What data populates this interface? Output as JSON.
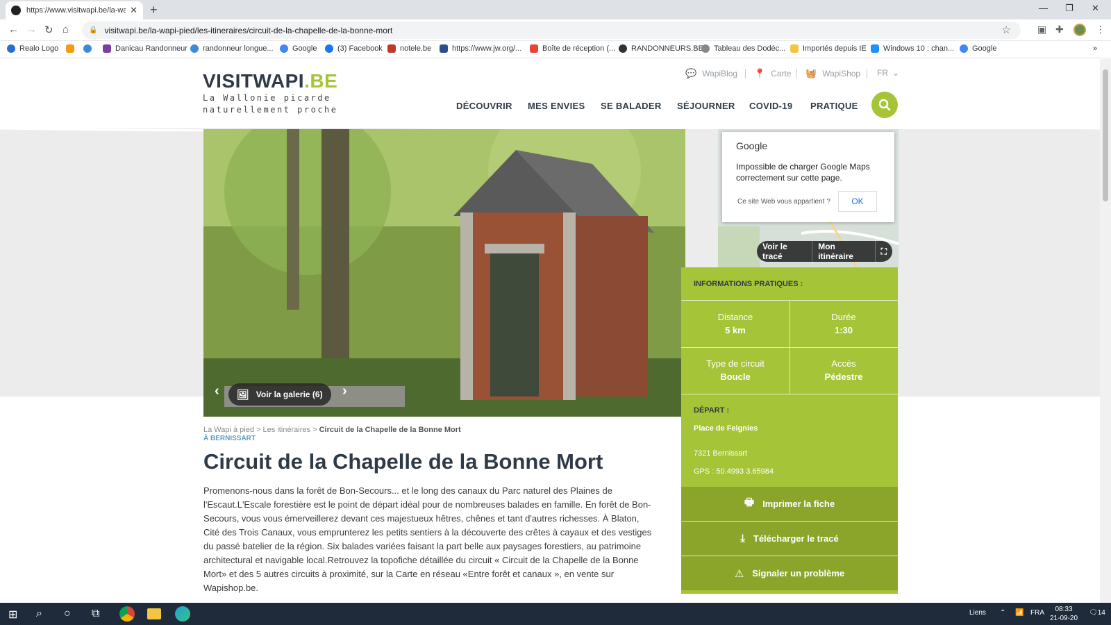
{
  "browser": {
    "tab_title": "https://www.visitwapi.be/la-wap",
    "url": "visitwapi.be/la-wapi-pied/les-itineraires/circuit-de-la-chapelle-de-la-bonne-mort",
    "bookmarks": [
      "Realo Logo",
      "",
      "",
      "Danicau Randonneur",
      "randonneur longue...",
      "Google",
      "(3) Facebook",
      "notele.be",
      "https://www.jw.org/...",
      "Boîte de réception (...",
      "RANDONNEURS.BE",
      "Tableau des Dodéc...",
      "Importés depuis IE",
      "Windows 10 : chan...",
      "Google"
    ]
  },
  "site": {
    "brand_main": "VISITWAPI",
    "brand_tld": ".BE",
    "tagline_1": "La Wallonie picarde",
    "tagline_2": "naturellement proche",
    "util_links": [
      "WapiBlog",
      "Carte",
      "WapiShop",
      "FR"
    ],
    "nav": [
      "DÉCOUVRIR",
      "MES ENVIES",
      "SE BALADER",
      "SÉJOURNER",
      "COVID-19",
      "PRATIQUE"
    ]
  },
  "hero": {
    "gallery_label": "Voir la galerie (6)"
  },
  "map": {
    "popup_title": "Google",
    "popup_message": "Impossible de charger Google Maps correctement sur cette page.",
    "popup_question": "Ce site Web vous appartient ?",
    "popup_ok": "OK",
    "btn_trace": "Voir le tracé",
    "btn_itinerary": "Mon itinéraire"
  },
  "info": {
    "header": "INFORMATIONS PRATIQUES :",
    "distance_label": "Distance",
    "distance_value": "5 km",
    "duration_label": "Durée",
    "duration_value": "1:30",
    "type_label": "Type de circuit",
    "type_value": "Boucle",
    "access_label": "Accès",
    "access_value": "Pédestre",
    "depart_label": "DÉPART :",
    "depart_place": "Place de Feignies",
    "depart_city": "7321 Bernissart",
    "gps": "GPS : 50.4993 3.65984",
    "btn_print": "Imprimer la fiche",
    "btn_download": "Télécharger le tracé",
    "btn_report": "Signaler un problème"
  },
  "article": {
    "crumb_1": "La Wapi à pied",
    "crumb_2": "Les itinéraires",
    "crumb_3": "Circuit de la Chapelle de la Bonne Mort",
    "location": "À BERNISSART",
    "title": "Circuit de la Chapelle de la Bonne Mort",
    "body": "Promenons-nous dans la forêt de Bon-Secours... et le long des canaux du Parc naturel des Plaines de l'Escaut.L'Escale forestière est le point de départ idéal pour de nombreuses balades en famille. En forêt de Bon-Secours, vous vous émerveillerez devant ces majestueux hêtres, chênes et tant d'autres richesses. À Blaton, Cité des Trois Canaux, vous emprunterez les petits sentiers à la découverte des crêtes à cayaux et des vestiges du passé batelier de la région. Six balades variées faisant la part belle aux paysages forestiers, au patrimoine architectural et navigable local.Retrouvez la topofiche détaillée du circuit « Circuit de la Chapelle de la Bonne Mort» et des 5 autres circuits à proximité, sur la Carte en réseau «Entre forêt et canaux », en vente sur Wapishop.be."
  },
  "taskbar": {
    "links_label": "Liens",
    "lang": "FRA",
    "time": "08:33",
    "date": "21-09-20",
    "notif_count": "14"
  },
  "colors": {
    "accent": "#a6c437",
    "dark": "#2e3a46"
  }
}
